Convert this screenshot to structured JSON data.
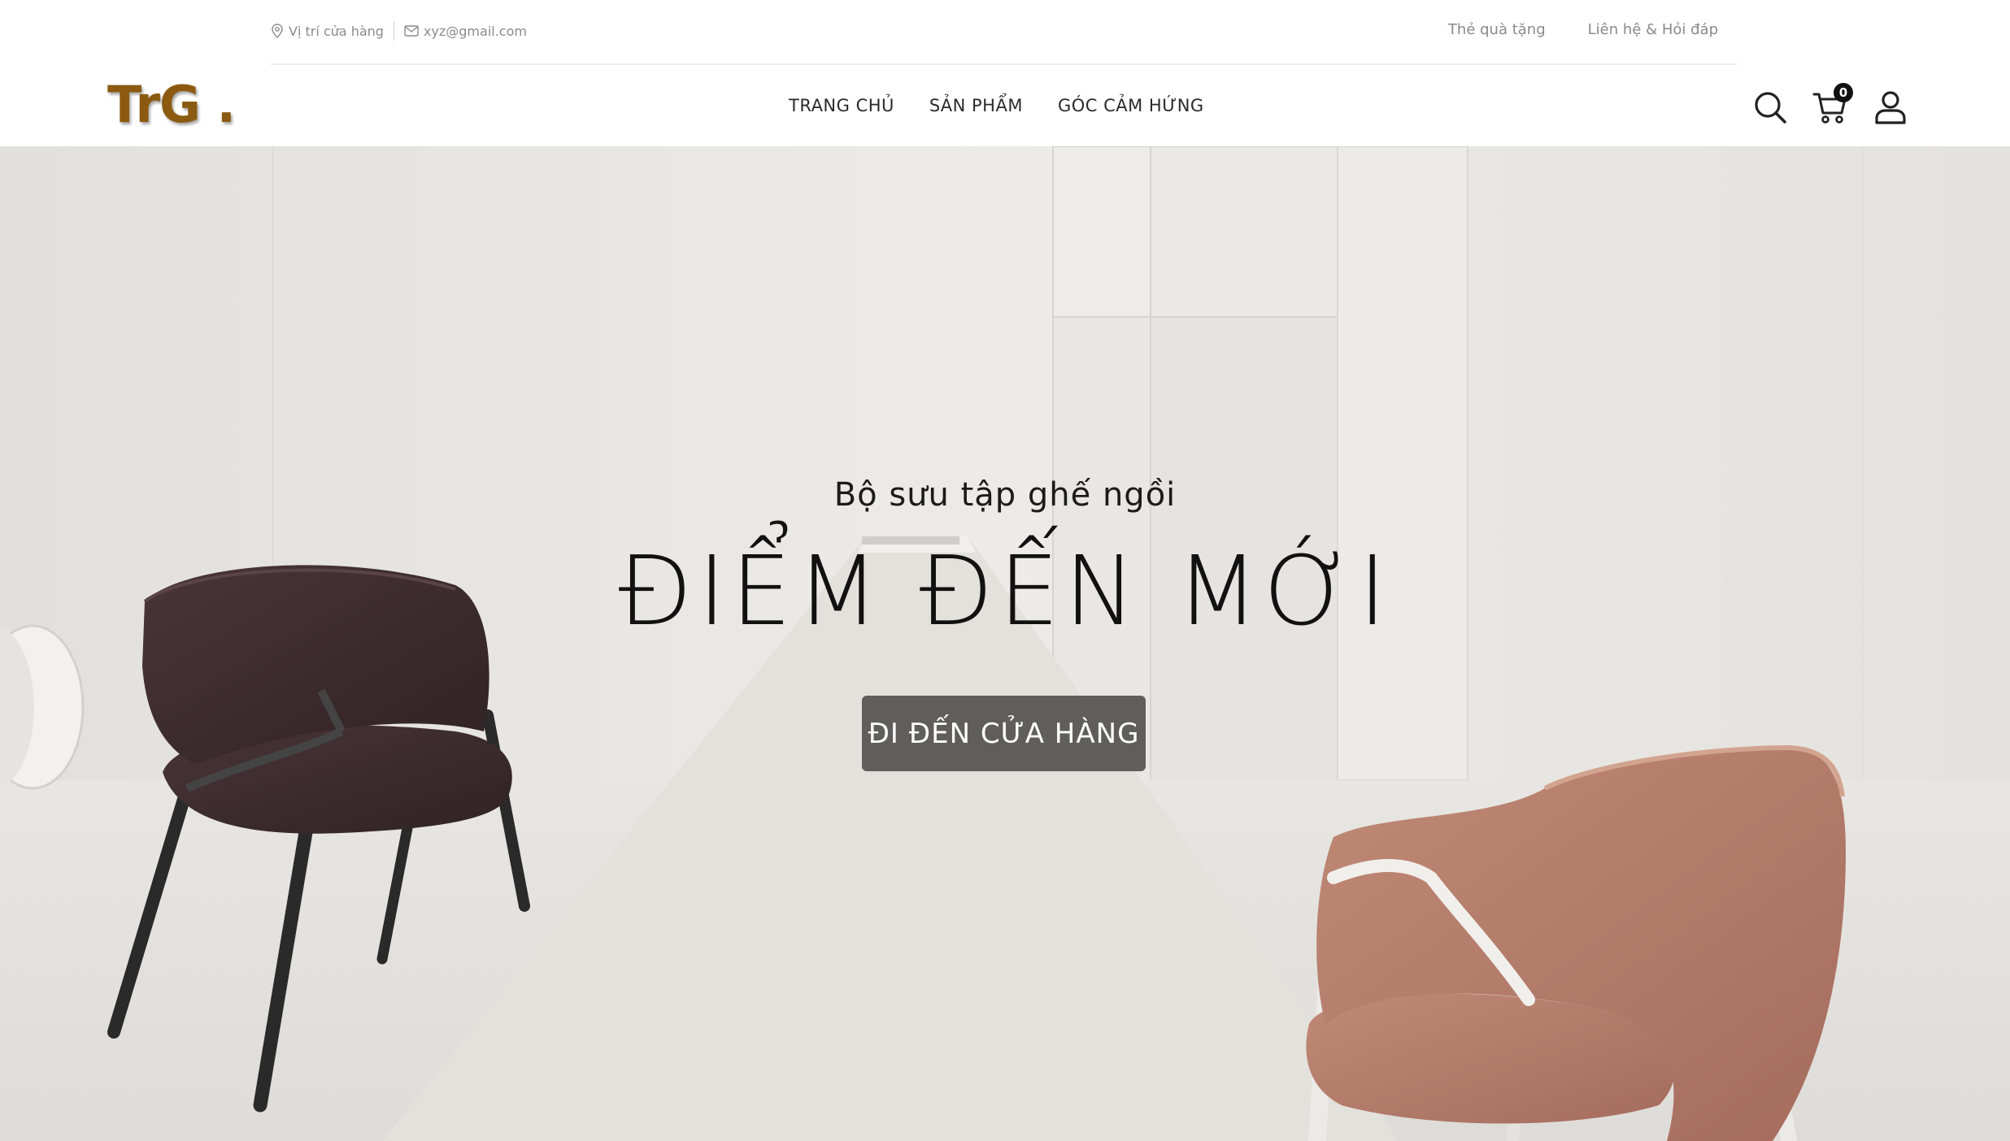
{
  "topbar": {
    "location_label": "Vị trí cửa hàng",
    "email_label": "xyz@gmail.com",
    "gift_label": "Thẻ quà tặng",
    "contact_label": "Liên hệ & Hỏi đáp"
  },
  "header": {
    "logo_text": "TrG .",
    "nav": [
      "TRANG CHỦ",
      "SẢN PHẨM",
      "GÓC CẢM HỨNG"
    ],
    "cart_count": "0",
    "icons": [
      "search-icon",
      "cart-icon",
      "user-icon"
    ]
  },
  "hero": {
    "subtitle": "Bộ sưu tập ghế ngồi",
    "title": "ĐIỂM ĐẾN MỚI",
    "cta_label": "ĐI ĐẾN CỬA HÀNG"
  },
  "colors": {
    "logo": "#8b5a10",
    "button_bg": "#5f5e5c",
    "hero_bg": "#e9e7e3",
    "chair_dark": "#3b2a2c",
    "chair_pink": "#b57b6c"
  }
}
